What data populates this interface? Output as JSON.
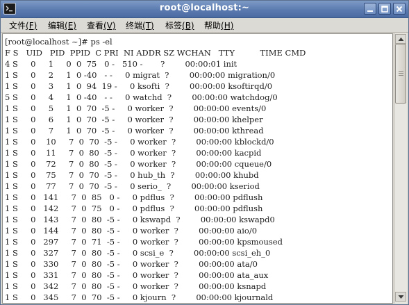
{
  "window": {
    "title": "root@localhost:~",
    "controls": {
      "minimize": "minimize-icon",
      "maximize": "maximize-icon",
      "close": "close-icon"
    }
  },
  "menubar": {
    "items": [
      {
        "label": "文件",
        "accel": "(F)"
      },
      {
        "label": "编辑",
        "accel": "(E)"
      },
      {
        "label": "查看",
        "accel": "(V)"
      },
      {
        "label": "终端",
        "accel": "(T)"
      },
      {
        "label": "标签",
        "accel": "(B)"
      },
      {
        "label": "帮助",
        "accel": "(H)"
      }
    ]
  },
  "terminal": {
    "lines": [
      "[root@localhost ~]# ps -el",
      "F S   UID   PID  PPID  C PRI  NI ADDR SZ WCHAN   TTY          TIME CMD",
      "4 S     0     1     0  0  75   0 -   510 -       ?        00:00:01 init",
      "1 S     0     2     1  0 -40   - -     0 migrat  ?        00:00:00 migration/0",
      "1 S     0     3     1  0  94  19 -     0 ksofti  ?        00:00:00 ksoftirqd/0",
      "5 S     0     4     1  0 -40   - -     0 watchd  ?        00:00:00 watchdog/0",
      "1 S     0     5     1  0  70  -5 -     0 worker  ?        00:00:00 events/0",
      "1 S     0     6     1  0  70  -5 -     0 worker  ?        00:00:00 khelper",
      "1 S     0     7     1  0  70  -5 -     0 worker  ?        00:00:00 kthread",
      "1 S     0    10     7  0  70  -5 -     0 worker  ?        00:00:00 kblockd/0",
      "1 S     0    11     7  0  80  -5 -     0 worker  ?        00:00:00 kacpid",
      "1 S     0    72     7  0  80  -5 -     0 worker  ?        00:00:00 cqueue/0",
      "1 S     0    75     7  0  70  -5 -     0 hub_th  ?        00:00:00 khubd",
      "1 S     0    77     7  0  70  -5 -     0 serio_  ?        00:00:00 kseriod",
      "1 S     0   141     7  0  85   0 -     0 pdflus  ?        00:00:00 pdflush",
      "1 S     0   142     7  0  75   0 -     0 pdflus  ?        00:00:00 pdflush",
      "1 S     0   143     7  0  80  -5 -     0 kswapd  ?        00:00:00 kswapd0",
      "1 S     0   144     7  0  80  -5 -     0 worker  ?        00:00:00 aio/0",
      "1 S     0   297     7  0  71  -5 -     0 worker  ?        00:00:00 kpsmoused",
      "1 S     0   327     7  0  80  -5 -     0 scsi_e  ?        00:00:00 scsi_eh_0",
      "1 S     0   330     7  0  80  -5 -     0 worker  ?        00:00:00 ata/0",
      "1 S     0   331     7  0  80  -5 -     0 worker  ?        00:00:00 ata_aux",
      "1 S     0   342     7  0  80  -5 -     0 worker  ?        00:00:00 ksnapd",
      "1 S     0   345     7  0  70  -5 -     0 kjourn  ?        00:00:00 kjournald"
    ]
  },
  "scrollbar": {
    "up": "scroll-up-arrow-icon",
    "down": "scroll-down-arrow-icon"
  },
  "colors": {
    "titlebar": "#5b7bb0",
    "terminal_bg": "#ffffff",
    "text": "#202020"
  }
}
